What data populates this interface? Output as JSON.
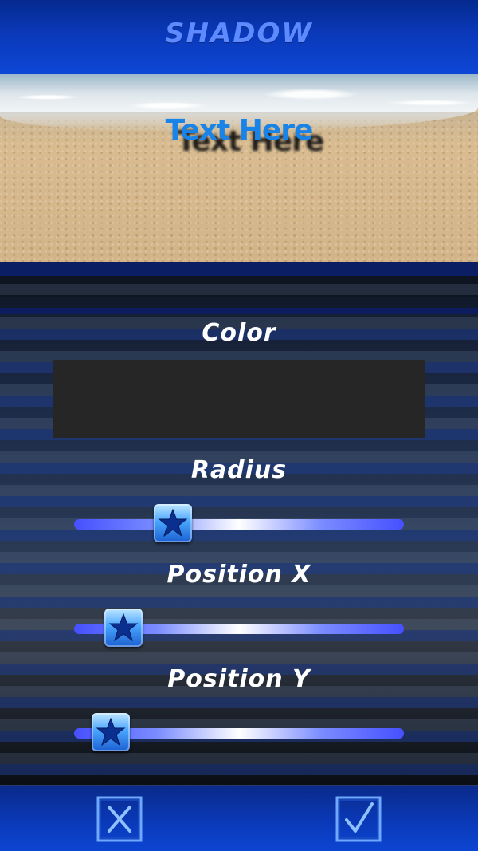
{
  "header": {
    "title": "SHADOW"
  },
  "preview": {
    "sample_text": "Text Here",
    "text_color": "#1a83e8",
    "shadow_color": "#0f0f0f"
  },
  "settings": {
    "color": {
      "label": "Color",
      "value": "#262626"
    },
    "radius": {
      "label": "Radius",
      "value": 0.3
    },
    "position_x": {
      "label": "Position X",
      "value": 0.15
    },
    "position_y": {
      "label": "Position Y",
      "value": 0.11
    }
  },
  "footer": {
    "cancel_icon": "close-icon",
    "confirm_icon": "checkmark-icon"
  },
  "colors": {
    "accent": "#0a39b9",
    "title": "#5d8bff",
    "slider_start": "#4650ff"
  }
}
